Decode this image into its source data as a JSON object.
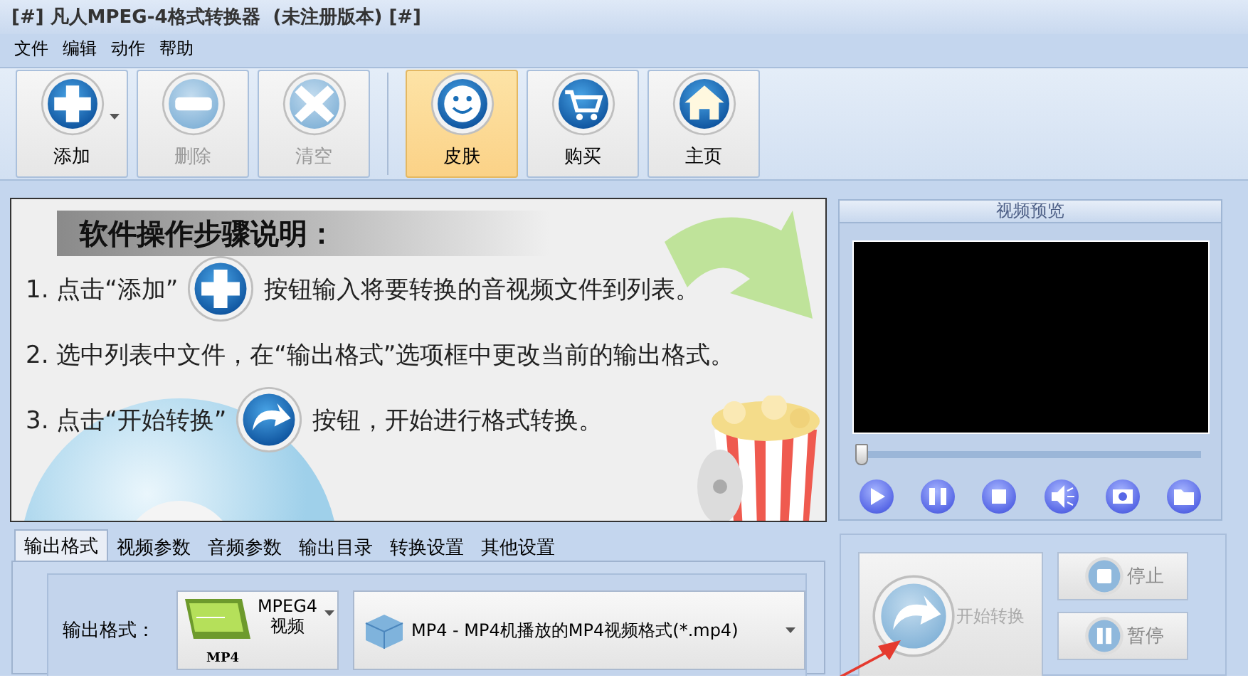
{
  "window": {
    "title": "[#] 凡人MPEG-4格式转换器  (未注册版本) [#]"
  },
  "menu": [
    "文件",
    "编辑",
    "动作",
    "帮助"
  ],
  "toolbar": [
    {
      "label": "添加",
      "kind": "plus",
      "disabled": false,
      "selected": false,
      "dropdown": true
    },
    {
      "label": "删除",
      "kind": "minus",
      "disabled": true,
      "selected": false,
      "dropdown": false
    },
    {
      "label": "清空",
      "kind": "cross",
      "disabled": true,
      "selected": false,
      "dropdown": false
    },
    {
      "label": "皮肤",
      "kind": "smile",
      "disabled": false,
      "selected": true,
      "dropdown": false
    },
    {
      "label": "购买",
      "kind": "cart",
      "disabled": false,
      "selected": false,
      "dropdown": false
    },
    {
      "label": "主页",
      "kind": "home",
      "disabled": false,
      "selected": false,
      "dropdown": false
    }
  ],
  "guide": {
    "heading": "软件操作步骤说明：",
    "steps": [
      {
        "before": "1. 点击“添加”",
        "kind": "plus",
        "after": "按钮输入将要转换的音视频文件到列表。"
      },
      {
        "before": "2. 选中列表中文件，在“输出格式”选项框中更改当前的输出格式。"
      },
      {
        "before": "3. 点击“开始转换”",
        "kind": "redo",
        "after": "按钮，开始进行格式转换。"
      }
    ]
  },
  "preview": {
    "title": "视频预览",
    "seek": {
      "level": 0
    }
  },
  "tabs": [
    {
      "label": "输出格式",
      "selected": true
    },
    {
      "label": "视频参数",
      "selected": false
    },
    {
      "label": "音频参数",
      "selected": false
    },
    {
      "label": "输出目录",
      "selected": false
    },
    {
      "label": "转换设置",
      "selected": false
    },
    {
      "label": "其他设置",
      "selected": false
    }
  ],
  "output": {
    "label": "输出格式：",
    "format": {
      "label": "MPEG4视频",
      "badge": "MP4"
    },
    "profile": "MP4 - MP4机播放的MP4视频格式(*.mp4)"
  },
  "actions": {
    "start": {
      "label": "开始转换",
      "disabled": true
    },
    "stop": {
      "label": "停止",
      "disabled": true
    },
    "pause": {
      "label": "暂停",
      "disabled": true
    }
  }
}
